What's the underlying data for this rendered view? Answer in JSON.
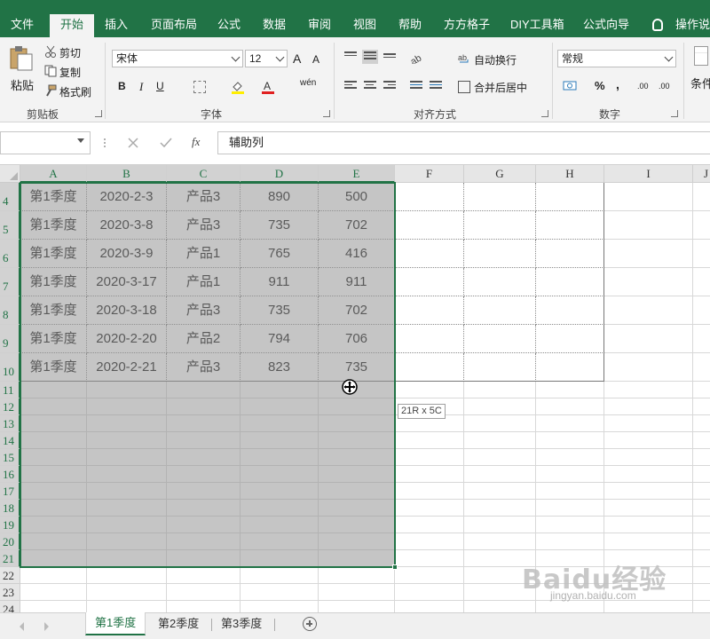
{
  "ribbon": {
    "tabs": [
      "文件",
      "开始",
      "插入",
      "页面布局",
      "公式",
      "数据",
      "审阅",
      "视图",
      "帮助",
      "方方格子",
      "DIY工具箱",
      "公式向导"
    ],
    "active_tab": "开始",
    "tell_me": "操作说明",
    "clipboard": {
      "title": "剪贴板",
      "paste": "粘贴",
      "cut": "剪切",
      "copy": "复制",
      "format_painter": "格式刷"
    },
    "font": {
      "title": "字体",
      "name": "宋体",
      "size": "12",
      "bold": "B",
      "italic": "I",
      "underline": "U",
      "grow": "A",
      "shrink": "A",
      "phonetic": "wén"
    },
    "alignment": {
      "title": "对齐方式",
      "wrap_text": "自动换行",
      "merge_center": "合并后居中"
    },
    "number": {
      "title": "数字",
      "format": "常规",
      "percent": "%",
      "comma": ",",
      "inc_decimal": ".00",
      "dec_decimal": ".00"
    },
    "styles": {
      "conditional": "条件"
    }
  },
  "formula_bar": {
    "name_box": "",
    "fx": "fx",
    "content": "辅助列"
  },
  "grid": {
    "columns": [
      "A",
      "B",
      "C",
      "D",
      "E",
      "F",
      "G",
      "H",
      "I",
      "J"
    ],
    "rows": [
      {
        "num": "4",
        "cells": [
          "第1季度",
          "2020-2-3",
          "产品3",
          "890",
          "500"
        ]
      },
      {
        "num": "5",
        "cells": [
          "第1季度",
          "2020-3-8",
          "产品3",
          "735",
          "702"
        ]
      },
      {
        "num": "6",
        "cells": [
          "第1季度",
          "2020-3-9",
          "产品1",
          "765",
          "416"
        ]
      },
      {
        "num": "7",
        "cells": [
          "第1季度",
          "2020-3-17",
          "产品1",
          "911",
          "911"
        ]
      },
      {
        "num": "8",
        "cells": [
          "第1季度",
          "2020-3-18",
          "产品3",
          "735",
          "702"
        ]
      },
      {
        "num": "9",
        "cells": [
          "第1季度",
          "2020-2-20",
          "产品2",
          "794",
          "706"
        ]
      },
      {
        "num": "10",
        "cells": [
          "第1季度",
          "2020-2-21",
          "产品3",
          "823",
          "735"
        ]
      },
      {
        "num": "11",
        "cells": [
          "",
          "",
          "",
          "",
          ""
        ]
      },
      {
        "num": "12",
        "cells": [
          "",
          "",
          "",
          "",
          ""
        ]
      },
      {
        "num": "13",
        "cells": [
          "",
          "",
          "",
          "",
          ""
        ]
      },
      {
        "num": "14",
        "cells": [
          "",
          "",
          "",
          "",
          ""
        ]
      },
      {
        "num": "15",
        "cells": [
          "",
          "",
          "",
          "",
          ""
        ]
      },
      {
        "num": "16",
        "cells": [
          "",
          "",
          "",
          "",
          ""
        ]
      },
      {
        "num": "17",
        "cells": [
          "",
          "",
          "",
          "",
          ""
        ]
      },
      {
        "num": "18",
        "cells": [
          "",
          "",
          "",
          "",
          ""
        ]
      },
      {
        "num": "19",
        "cells": [
          "",
          "",
          "",
          "",
          ""
        ]
      },
      {
        "num": "20",
        "cells": [
          "",
          "",
          "",
          "",
          ""
        ]
      },
      {
        "num": "21",
        "cells": [
          "",
          "",
          "",
          "",
          ""
        ]
      },
      {
        "num": "22",
        "cells": [
          "",
          "",
          "",
          "",
          ""
        ]
      },
      {
        "num": "23",
        "cells": [
          "",
          "",
          "",
          "",
          ""
        ]
      },
      {
        "num": "24",
        "cells": [
          "",
          "",
          "",
          "",
          ""
        ]
      }
    ],
    "selection_size_tip": "21R x 5C",
    "selection_color": "#217346"
  },
  "sheets": {
    "tabs": [
      "第1季度",
      "第2季度",
      "第3季度"
    ],
    "active": "第1季度"
  },
  "watermark": {
    "logo": "Baidu经验",
    "url": "jingyan.baidu.com"
  }
}
